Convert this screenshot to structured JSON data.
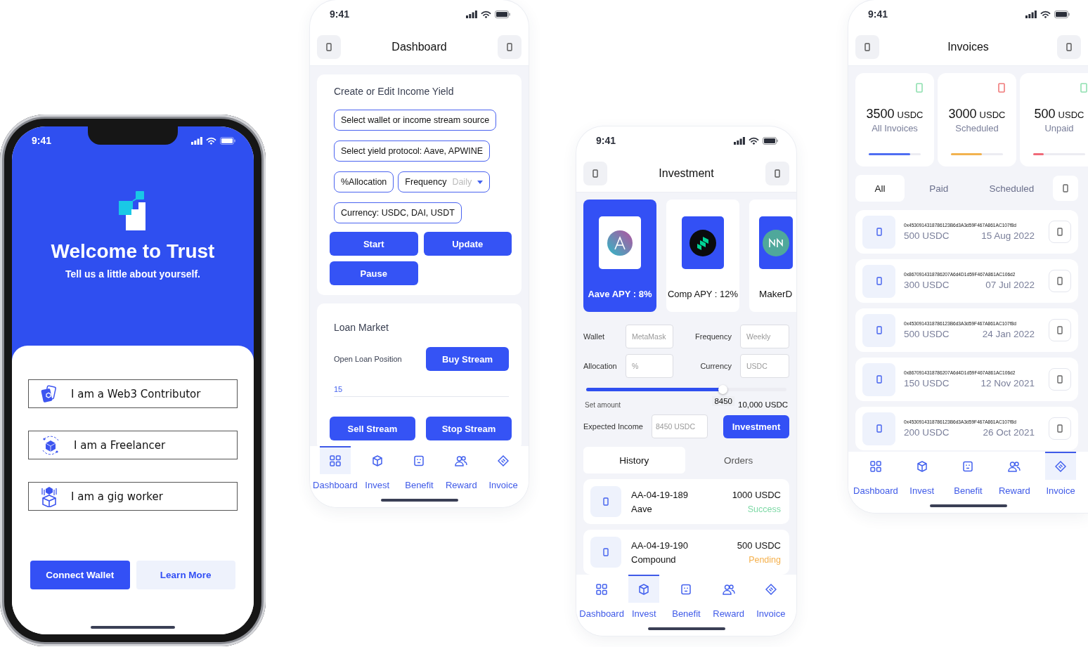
{
  "welcome": {
    "status_time": "9:41",
    "title": "Welcome to Trust",
    "subtitle": "Tell us a little about yourself.",
    "options": [
      {
        "kind": "cards",
        "label": "I am a Web3 Contributor"
      },
      {
        "kind": "cube",
        "label": "I am a Freelancer"
      },
      {
        "kind": "worker",
        "label": "I am a gig worker"
      }
    ],
    "buttons": [
      {
        "kind": "primary",
        "label": "Connect Wallet"
      },
      {
        "kind": "secondary",
        "label": "Learn More"
      }
    ]
  },
  "dashboard": {
    "status_time": "9:41",
    "title": "Dashboard",
    "yield_card": {
      "title": "Create or Edit Income Yield",
      "fields": [
        {
          "kind": "select",
          "text": "Select wallet or income stream source"
        },
        {
          "kind": "select",
          "text": "Select yield protocol: Aave, APWINE"
        },
        {
          "kind": "select",
          "text": "%Allocation"
        },
        {
          "kind": "dropdown",
          "text": "Frequency",
          "placeholder": "Daily"
        },
        {
          "kind": "select",
          "text": "Currency: USDC, DAI, USDT"
        }
      ],
      "buttons": [
        "Start",
        "Update",
        "Pause"
      ]
    },
    "loan_card": {
      "title": "Loan Market",
      "label": "Open Loan Position",
      "buy_button": "Buy Stream",
      "value": "15",
      "sell_button": "Sell Stream",
      "stop_button": "Stop Stream"
    },
    "nav": [
      {
        "kind": "dashboard",
        "label": "Dashboard",
        "selected": true
      },
      {
        "kind": "invest",
        "label": "Invest",
        "selected": false
      },
      {
        "kind": "benefit",
        "label": "Benefit",
        "selected": false
      },
      {
        "kind": "reward",
        "label": "Reward",
        "selected": false
      },
      {
        "kind": "invoice",
        "label": "Invoice",
        "selected": false
      }
    ]
  },
  "investment": {
    "status_time": "9:41",
    "title": "Investment",
    "protocols": [
      {
        "kind": "aave",
        "label": "Aave APY : 8%",
        "selected": true
      },
      {
        "kind": "comp",
        "label": "Comp APY : 12%",
        "selected": false
      },
      {
        "kind": "maker",
        "label": "MakerD",
        "selected": false
      }
    ],
    "form": [
      {
        "label": "Wallet",
        "placeholder": "MetaMask"
      },
      {
        "label": "Frequency",
        "placeholder": "Weekly"
      },
      {
        "label": "Allocation",
        "placeholder": "%"
      },
      {
        "label": "Currency",
        "placeholder": "USDC"
      }
    ],
    "slider": {
      "level": 0.68,
      "label": "Set amount",
      "value": "8450",
      "max": "10,000 USDC"
    },
    "expected": {
      "label": "Expected Income",
      "placeholder": "8450 USDC"
    },
    "invest_button": "Investment",
    "tabs": [
      {
        "label": "History",
        "selected": true
      },
      {
        "label": "Orders",
        "selected": false
      }
    ],
    "orders": [
      {
        "id": "AA-04-19-189",
        "protocol": "Aave",
        "amount": "1000 USDC",
        "status": "Success",
        "color": "#7ed9a6"
      },
      {
        "id": "AA-04-19-190",
        "protocol": "Compound",
        "amount": "500 USDC",
        "status": "Pending",
        "color": "#f5b04c"
      }
    ],
    "nav": [
      {
        "kind": "dashboard",
        "label": "Dashboard",
        "selected": false
      },
      {
        "kind": "invest",
        "label": "Invest",
        "selected": true
      },
      {
        "kind": "benefit",
        "label": "Benefit",
        "selected": false
      },
      {
        "kind": "reward",
        "label": "Reward",
        "selected": false
      },
      {
        "kind": "invoice",
        "label": "Invoice",
        "selected": false
      }
    ]
  },
  "invoices": {
    "status_time": "9:41",
    "title": "Invoices",
    "stats": [
      {
        "amount": "3500",
        "unit": "USDC",
        "label": "All Invoices",
        "level": 0.8,
        "color": "#4f6ef2",
        "alert": false
      },
      {
        "amount": "3000",
        "unit": "USDC",
        "label": "Scheduled",
        "level": 0.6,
        "color": "#f2b34f",
        "alert": true
      },
      {
        "amount": "500",
        "unit": "USDC",
        "label": "Unpaid",
        "level": 0.2,
        "color": "#f06a78",
        "alert": false
      }
    ],
    "filters": [
      {
        "label": "All",
        "selected": true
      },
      {
        "label": "Paid",
        "selected": false
      },
      {
        "label": "Scheduled",
        "selected": false
      }
    ],
    "rows": [
      {
        "hash": "0x4530914318786123B6d3A3d59F467A861AC107f8d",
        "amount": "500 USDC",
        "date": "15 Aug 2022"
      },
      {
        "hash": "0x8670914318786207A6d4D1d59F467A861AC106d2",
        "amount": "300 USDC",
        "date": "07 Jul 2022"
      },
      {
        "hash": "0x4530914318786123B6d3A3d59F467A861AC107f8d",
        "amount": "500 USDC",
        "date": "24 Jan 2022"
      },
      {
        "hash": "0x8670914318786207A6d4D1d59F467A861AC106d2",
        "amount": "150 USDC",
        "date": "12 Nov 2021"
      },
      {
        "hash": "0x4530914318786123B6d3A3d59F467A861AC107f8d",
        "amount": "200 USDC",
        "date": "26 Oct 2021"
      }
    ],
    "nav": [
      {
        "kind": "dashboard",
        "label": "Dashboard",
        "selected": false
      },
      {
        "kind": "invest",
        "label": "Invest",
        "selected": false
      },
      {
        "kind": "benefit",
        "label": "Benefit",
        "selected": false
      },
      {
        "kind": "reward",
        "label": "Reward",
        "selected": false
      },
      {
        "kind": "invoice",
        "label": "Invoice",
        "selected": true
      }
    ]
  }
}
